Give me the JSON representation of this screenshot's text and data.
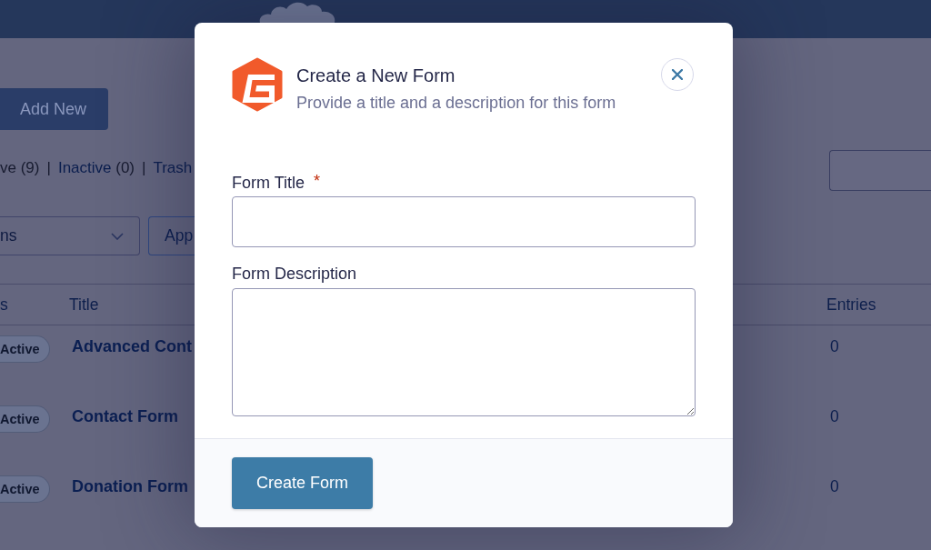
{
  "page": {
    "add_new_button": "Add New",
    "filters": [
      {
        "kind": "link",
        "label": "ve",
        "count": "(9)",
        "selected": true
      },
      {
        "kind": "separator",
        "text": "|"
      },
      {
        "kind": "link",
        "label": "Inactive",
        "count": "(0)",
        "selected": false
      },
      {
        "kind": "separator",
        "text": "|"
      },
      {
        "kind": "link",
        "label": "Trash",
        "selected": false
      }
    ],
    "bulk_actions": {
      "value": "ns"
    },
    "apply_button": "App",
    "table": {
      "columns": [
        "s",
        "Title",
        "Entries"
      ],
      "rows": [
        {
          "status": "Active",
          "title": "Advanced Cont",
          "entries": "0"
        },
        {
          "status": "Active",
          "title": "Contact Form",
          "entries": "0"
        },
        {
          "status": "Active",
          "title": "Donation Form",
          "entries": "0"
        }
      ]
    }
  },
  "dialog": {
    "title": "Create a New Form",
    "subtitle": "Provide a title and a description for this form",
    "fields": [
      {
        "kind": "text",
        "label": "Form Title",
        "required_mark": "*"
      },
      {
        "kind": "textarea",
        "label": "Form Description"
      }
    ],
    "buttons": [
      "Create Form"
    ]
  }
}
